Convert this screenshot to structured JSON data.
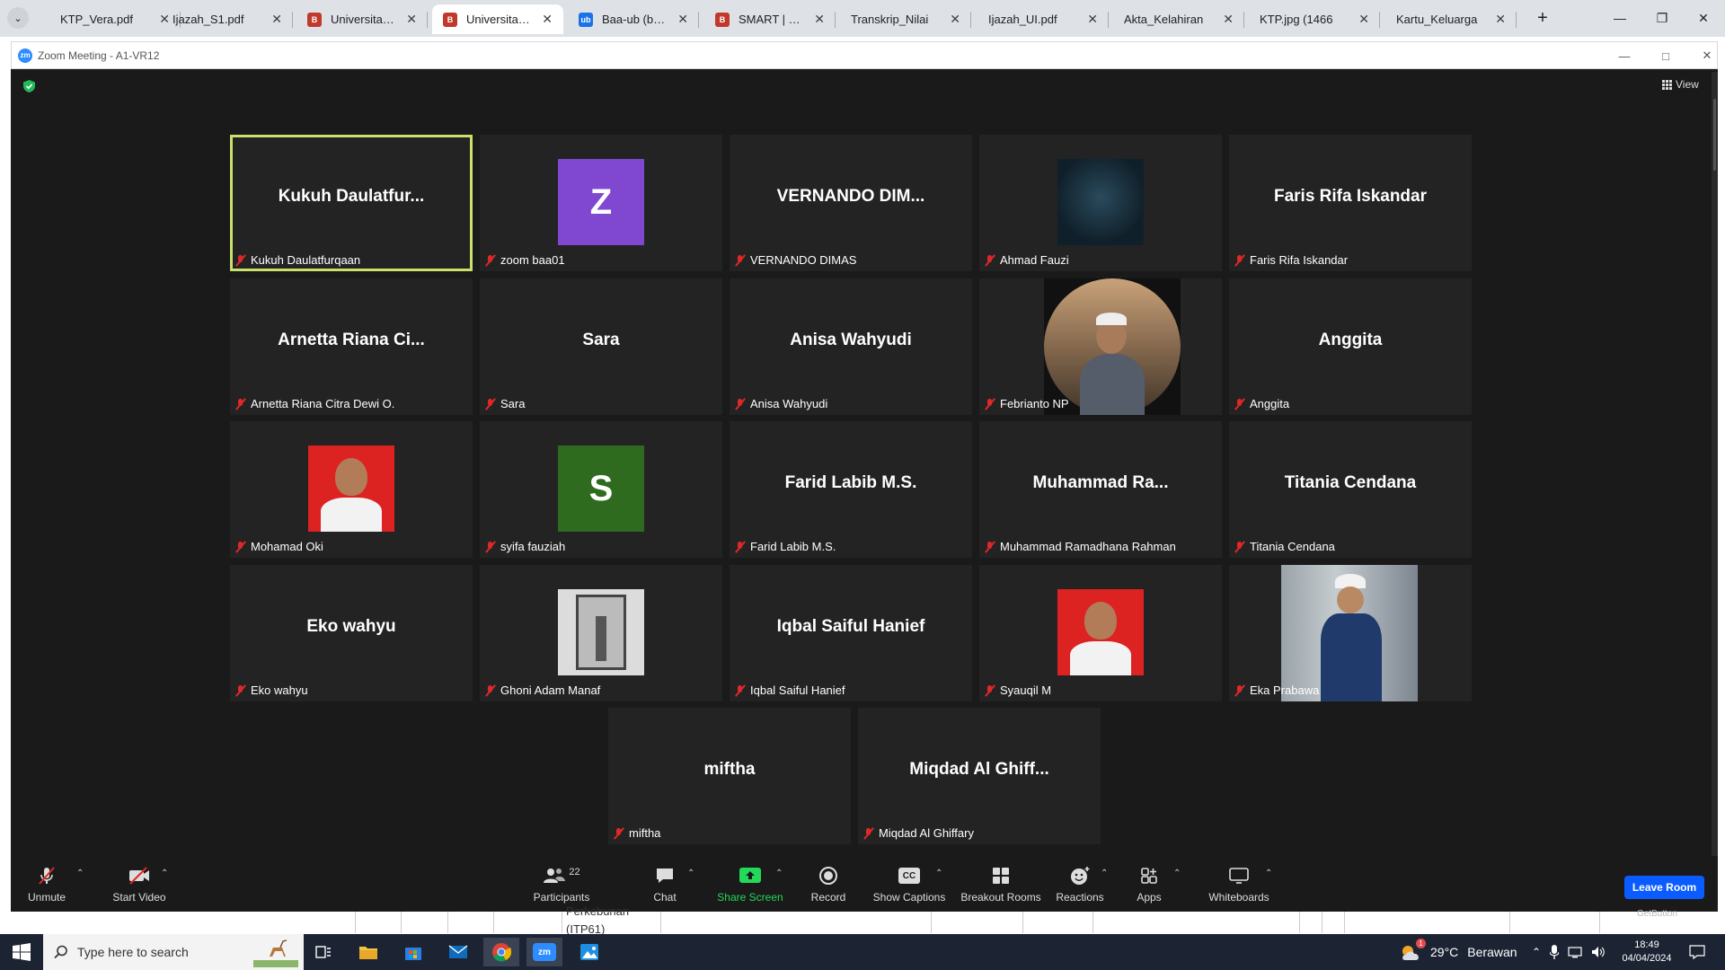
{
  "browser": {
    "tabs": [
      {
        "label": "KTP_Vera.pdf",
        "favicon": "none",
        "active": false
      },
      {
        "label": "Ijazah_S1.pdf",
        "favicon": "none",
        "active": false
      },
      {
        "label": "Universitas Bak",
        "favicon": "bakrie-shield",
        "active": false
      },
      {
        "label": "Universitas Bak",
        "favicon": "bakrie-shield",
        "active": true
      },
      {
        "label": "Baa-ub (baa-ub",
        "favicon": "ub-logo",
        "active": false
      },
      {
        "label": "SMART | BAKRI",
        "favicon": "bakrie-shield",
        "active": false
      },
      {
        "label": "Transkrip_Nilai",
        "favicon": "none",
        "active": false
      },
      {
        "label": "Ijazah_UI.pdf",
        "favicon": "none",
        "active": false
      },
      {
        "label": "Akta_Kelahiran",
        "favicon": "none",
        "active": false
      },
      {
        "label": "KTP.jpg (1466",
        "favicon": "none",
        "active": false
      },
      {
        "label": "Kartu_Keluarga",
        "favicon": "none",
        "active": false
      }
    ],
    "close_glyph": "✕",
    "newtab_glyph": "+",
    "menu_glyph": "⌄"
  },
  "zoom": {
    "title": "Zoom Meeting - A1-VR12",
    "logo_text": "zm",
    "view_label": "View",
    "leave_label": "Leave Room",
    "accent_color": "#0b5cff",
    "active_speaker_color": "#c9e06b"
  },
  "participants": [
    {
      "display": "Kukuh  Daulatfur...",
      "label": "Kukuh Daulatfurqaan",
      "kind": "name",
      "active": true
    },
    {
      "display": "Z",
      "label": "zoom baa01",
      "kind": "letter",
      "color": "#8048d0"
    },
    {
      "display": "VERNANDO  DIM...",
      "label": "VERNANDO DIMAS",
      "kind": "name"
    },
    {
      "display": "",
      "label": "Ahmad Fauzi",
      "kind": "photo-dark"
    },
    {
      "display": "Faris Rifa Iskandar",
      "label": "Faris Rifa Iskandar",
      "kind": "name"
    },
    {
      "display": "Arnetta  Riana  Ci...",
      "label": "Arnetta Riana Citra Dewi O.",
      "kind": "name"
    },
    {
      "display": "Sara",
      "label": "Sara",
      "kind": "name"
    },
    {
      "display": "Anisa Wahyudi",
      "label": "Anisa Wahyudi",
      "kind": "name"
    },
    {
      "display": "",
      "label": "Febrianto NP",
      "kind": "photo-circle"
    },
    {
      "display": "Anggita",
      "label": "Anggita",
      "kind": "name"
    },
    {
      "display": "",
      "label": "Mohamad Oki",
      "kind": "photo-red"
    },
    {
      "display": "S",
      "label": "syifa fauziah",
      "kind": "letter",
      "color": "#2e6b1f"
    },
    {
      "display": "Farid Labib M.S.",
      "label": "Farid Labib M.S.",
      "kind": "name"
    },
    {
      "display": "Muhammad  Ra...",
      "label": "Muhammad Ramadhana Rahman",
      "kind": "name"
    },
    {
      "display": "Titania Cendana",
      "label": "Titania Cendana",
      "kind": "name"
    },
    {
      "display": "Eko wahyu",
      "label": "Eko wahyu",
      "kind": "name"
    },
    {
      "display": "",
      "label": "Ghoni Adam Manaf",
      "kind": "photo-gray"
    },
    {
      "display": "Iqbal Saiful Hanief",
      "label": "Iqbal Saiful Hanief",
      "kind": "name"
    },
    {
      "display": "",
      "label": "Syauqil M",
      "kind": "photo-red"
    },
    {
      "display": "",
      "label": "Eka Prabawa",
      "kind": "photo-site"
    },
    {
      "display": "miftha",
      "label": "miftha",
      "kind": "name"
    },
    {
      "display": "Miqdad  Al  Ghiff...",
      "label": "Miqdad Al Ghiffary",
      "kind": "name"
    }
  ],
  "toolbar": {
    "unmute": "Unmute",
    "start_video": "Start Video",
    "participants": "Participants",
    "participants_count": "22",
    "chat": "Chat",
    "share_screen": "Share Screen",
    "record": "Record",
    "show_captions": "Show Captions",
    "breakout_rooms": "Breakout Rooms",
    "reactions": "Reactions",
    "apps": "Apps",
    "whiteboards": "Whiteboards",
    "share_color": "#23d959",
    "cc_text": "CC"
  },
  "underlying": {
    "text_line1": "Perkebunan",
    "text_line2": "(ITP61)",
    "getbutton": "GetButton"
  },
  "taskbar": {
    "search_placeholder": "Type here to search",
    "weather_temp": "29°C",
    "weather_desc": "Berawan",
    "time": "18:49",
    "date": "04/04/2024",
    "weather_badge": "1"
  }
}
